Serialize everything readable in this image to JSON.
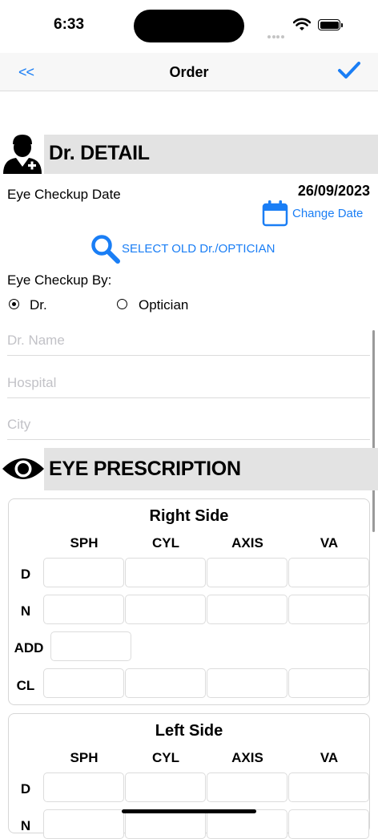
{
  "status_bar": {
    "time": "6:33"
  },
  "nav": {
    "back_label": "<<",
    "title": "Order",
    "confirm_icon": "checkmark-icon"
  },
  "doctor_section": {
    "title": "Dr. DETAIL",
    "checkup_date_label": "Eye Checkup Date",
    "checkup_date_value": "26/09/2023",
    "change_date_label": "Change Date",
    "select_old_label": "SELECT OLD Dr./OPTICIAN",
    "checkup_by_label": "Eye Checkup By:",
    "options": [
      {
        "label": "Dr.",
        "selected": true
      },
      {
        "label": "Optician",
        "selected": false
      }
    ],
    "fields": [
      {
        "placeholder": "Dr. Name",
        "value": ""
      },
      {
        "placeholder": "Hospital",
        "value": ""
      },
      {
        "placeholder": "City",
        "value": ""
      }
    ]
  },
  "prescription_section": {
    "title": "EYE PRESCRIPTION",
    "columns": [
      "SPH",
      "CYL",
      "AXIS",
      "VA"
    ],
    "right": {
      "title": "Right Side",
      "rows": [
        "D",
        "N",
        "ADD",
        "CL"
      ]
    },
    "left": {
      "title": "Left Side",
      "rows": [
        "D",
        "N"
      ]
    }
  },
  "colors": {
    "accent": "#1a7ef5",
    "section_bar": "#e3e3e3",
    "placeholder": "#c2c2c7"
  }
}
